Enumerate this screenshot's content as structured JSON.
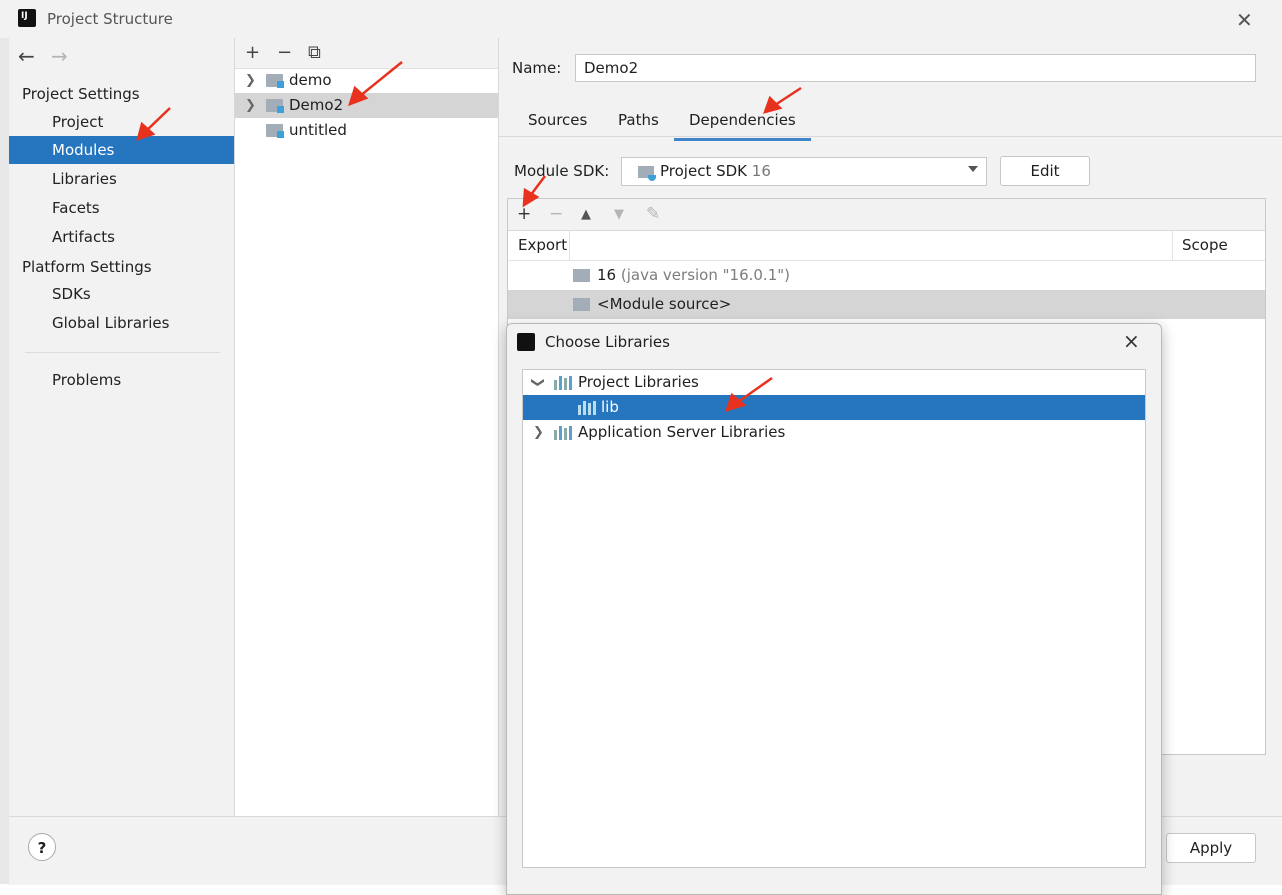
{
  "window": {
    "title": "Project Structure"
  },
  "nav": {
    "back": "←",
    "forward": "→"
  },
  "sidebar": {
    "project_settings_header": "Project Settings",
    "items": [
      "Project",
      "Modules",
      "Libraries",
      "Facets",
      "Artifacts"
    ],
    "platform_settings_header": "Platform Settings",
    "platform_items": [
      "SDKs",
      "Global Libraries"
    ],
    "problems": "Problems",
    "selected": "Modules"
  },
  "modules": {
    "toolbar": {
      "add": "+",
      "remove": "−",
      "copy": "⧉"
    },
    "list": [
      "demo",
      "Demo2",
      "untitled"
    ]
  },
  "module_detail": {
    "name_label": "Name:",
    "name_value": "Demo2",
    "tabs": [
      "Sources",
      "Paths",
      "Dependencies"
    ],
    "active_tab": "Dependencies",
    "sdk_label": "Module SDK:",
    "sdk_value": "Project SDK",
    "sdk_version": "16",
    "edit_button": "Edit",
    "dep_toolbar": {
      "add": "+",
      "remove": "−",
      "up": "▲",
      "down": "▼",
      "edit": "✎"
    },
    "columns": {
      "export": "Export",
      "scope": "Scope"
    },
    "rows": [
      {
        "name": "16",
        "detail": "(java version \"16.0.1\")"
      },
      {
        "name": "<Module source>",
        "detail": ""
      }
    ]
  },
  "footer": {
    "help": "?",
    "apply": "Apply"
  },
  "dialog": {
    "title": "Choose Libraries",
    "close": "×",
    "tree": [
      {
        "label": "Project Libraries",
        "expanded": true
      },
      {
        "label": "lib",
        "selected": true
      },
      {
        "label": "Application Server Libraries",
        "expanded": false
      }
    ]
  },
  "colors": {
    "selection": "#2675bf",
    "annotation_arrow": "#e8321e",
    "tab_underline": "#4083c9"
  }
}
